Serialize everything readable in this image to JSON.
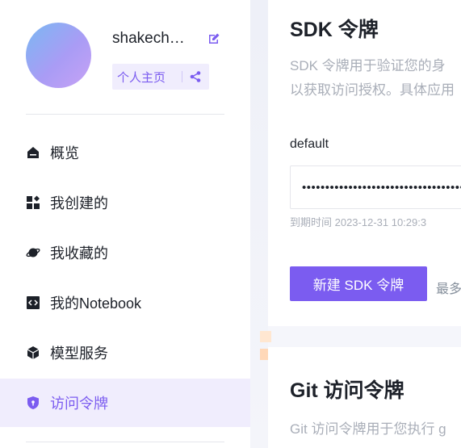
{
  "profile": {
    "username": "shakech…",
    "homepage_label": "个人主页"
  },
  "nav": {
    "items": [
      {
        "label": "概览",
        "icon": "home-icon"
      },
      {
        "label": "我创建的",
        "icon": "grid-plus-icon"
      },
      {
        "label": "我收藏的",
        "icon": "planet-icon"
      },
      {
        "label": "我的Notebook",
        "icon": "code-notebook-icon"
      },
      {
        "label": "模型服务",
        "icon": "cube-icon"
      },
      {
        "label": "访问令牌",
        "icon": "key-shield-icon",
        "active": true
      }
    ]
  },
  "sdk": {
    "title": "SDK 令牌",
    "desc_line1": "SDK 令牌用于验证您的身",
    "desc_line2": "以获取访问授权。具体应用",
    "token_name": "default",
    "token_masked": "••••••••••••••••••••••••••••••••••••",
    "expire_label": "到期时间 2023-12-31 10:29:3",
    "new_button": "新建 SDK 令牌",
    "more_text": "最多"
  },
  "git": {
    "title": "Git 访问令牌",
    "desc_line1": "Git 访问令牌用于您执行 g"
  },
  "colors": {
    "accent": "#7b5cf0",
    "accent_bg": "#f0edfd",
    "muted_text": "#a9aeb8"
  }
}
